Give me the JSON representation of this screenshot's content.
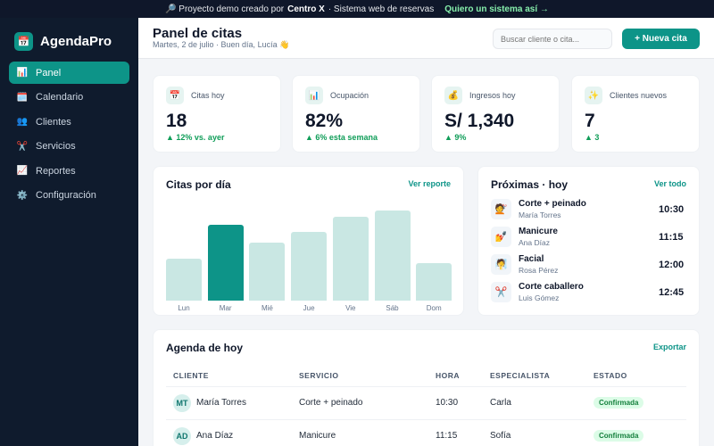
{
  "banner": {
    "prefix": "🔎 Proyecto demo creado por",
    "author": "Centro X",
    "suffix": "· Sistema web de reservas",
    "cta": "Quiero un sistema así →"
  },
  "app": {
    "logo_icon": "📅",
    "name": "AgendaPro"
  },
  "sidebar": {
    "items": [
      {
        "icon": "📊",
        "label": "Panel",
        "active": true
      },
      {
        "icon": "🗓️",
        "label": "Calendario"
      },
      {
        "icon": "👥",
        "label": "Clientes"
      },
      {
        "icon": "✂️",
        "label": "Servicios"
      },
      {
        "icon": "📈",
        "label": "Reportes"
      },
      {
        "icon": "⚙️",
        "label": "Configuración"
      }
    ]
  },
  "header": {
    "title": "Panel de citas",
    "subtitle": "Martes, 2 de julio · Buen día, Lucía 👋",
    "search_placeholder": "Buscar cliente o cita...",
    "new_button": "+ Nueva cita"
  },
  "kpis": [
    {
      "icon": "📅",
      "label": "Citas hoy",
      "value": "18",
      "delta": "▲ 12% vs. ayer"
    },
    {
      "icon": "📊",
      "label": "Ocupación",
      "value": "82%",
      "delta": "▲ 6% esta semana"
    },
    {
      "icon": "💰",
      "label": "Ingresos hoy",
      "value": "S/ 1,340",
      "delta": "▲ 9%"
    },
    {
      "icon": "✨",
      "label": "Clientes nuevos",
      "value": "7",
      "delta": "▲ 3"
    }
  ],
  "chart_card": {
    "title": "Citas por día",
    "link": "Ver reporte"
  },
  "chart_data": {
    "type": "bar",
    "categories": [
      "Lun",
      "Mar",
      "Mié",
      "Jue",
      "Vie",
      "Sáb",
      "Dom"
    ],
    "values": [
      40,
      72,
      55,
      65,
      80,
      86,
      36
    ],
    "highlight_index": 1,
    "ylim": [
      0,
      100
    ],
    "colors": {
      "bar": "#c9e7e3",
      "highlight": "#0d9488"
    }
  },
  "upcoming": {
    "title": "Próximas · hoy",
    "link": "Ver todo",
    "items": [
      {
        "icon": "💇",
        "service": "Corte + peinado",
        "client": "María Torres",
        "time": "10:30"
      },
      {
        "icon": "💅",
        "service": "Manicure",
        "client": "Ana Díaz",
        "time": "11:15"
      },
      {
        "icon": "🧖",
        "service": "Facial",
        "client": "Rosa Pérez",
        "time": "12:00"
      },
      {
        "icon": "✂️",
        "service": "Corte caballero",
        "client": "Luis Gómez",
        "time": "12:45"
      }
    ]
  },
  "agenda": {
    "title": "Agenda de hoy",
    "link": "Exportar",
    "columns": [
      "CLIENTE",
      "SERVICIO",
      "HORA",
      "ESPECIALISTA",
      "ESTADO"
    ],
    "rows": [
      {
        "initials": "MT",
        "client": "María Torres",
        "service": "Corte + peinado",
        "time": "10:30",
        "specialist": "Carla",
        "status": "Confirmada"
      },
      {
        "initials": "AD",
        "client": "Ana Díaz",
        "service": "Manicure",
        "time": "11:15",
        "specialist": "Sofía",
        "status": "Confirmada"
      }
    ]
  },
  "colors": {
    "accent": "#0d9488",
    "sidebar": "#0f1b2d",
    "banner": "#0f172a",
    "success": "#15803d"
  }
}
